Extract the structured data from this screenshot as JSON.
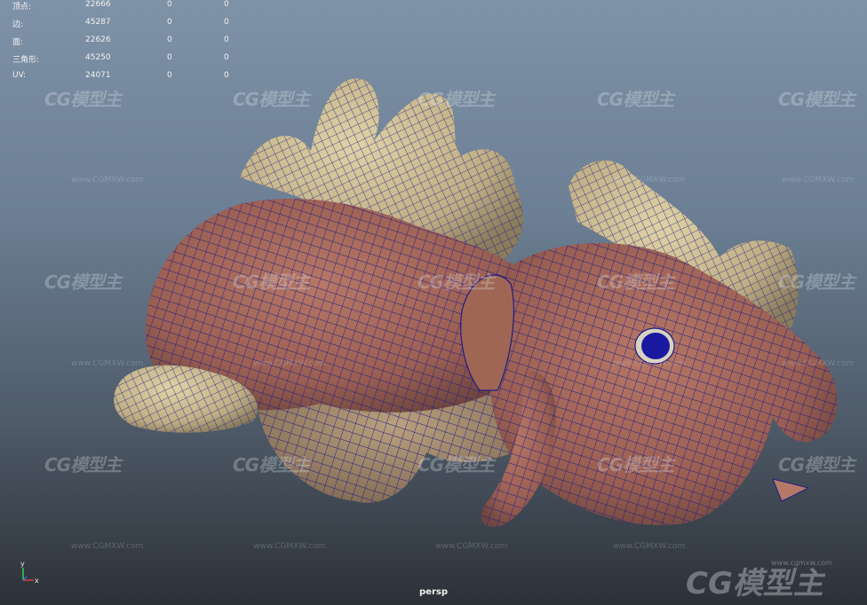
{
  "hud": {
    "rows": [
      {
        "label": "顶点:",
        "v1": "22666",
        "v2": "0",
        "v3": "0"
      },
      {
        "label": "边:",
        "v1": "45287",
        "v2": "0",
        "v3": "0"
      },
      {
        "label": "面:",
        "v1": "22626",
        "v2": "0",
        "v3": "0"
      },
      {
        "label": "三角形:",
        "v1": "45250",
        "v2": "0",
        "v3": "0"
      },
      {
        "label": "UV:",
        "v1": "24071",
        "v2": "0",
        "v3": "0"
      }
    ]
  },
  "camera": {
    "name": "persp"
  },
  "watermark": {
    "logo": "CG模型主",
    "url": "www.CGMXW.com",
    "big_url": "www.cgmxw.com"
  },
  "axis": {
    "y": "y",
    "x": "x"
  },
  "colors": {
    "body_skin": "#a8675a",
    "spikes": "#c9b890",
    "wire": "#1e1c86",
    "eye": "#1a1aa0"
  }
}
